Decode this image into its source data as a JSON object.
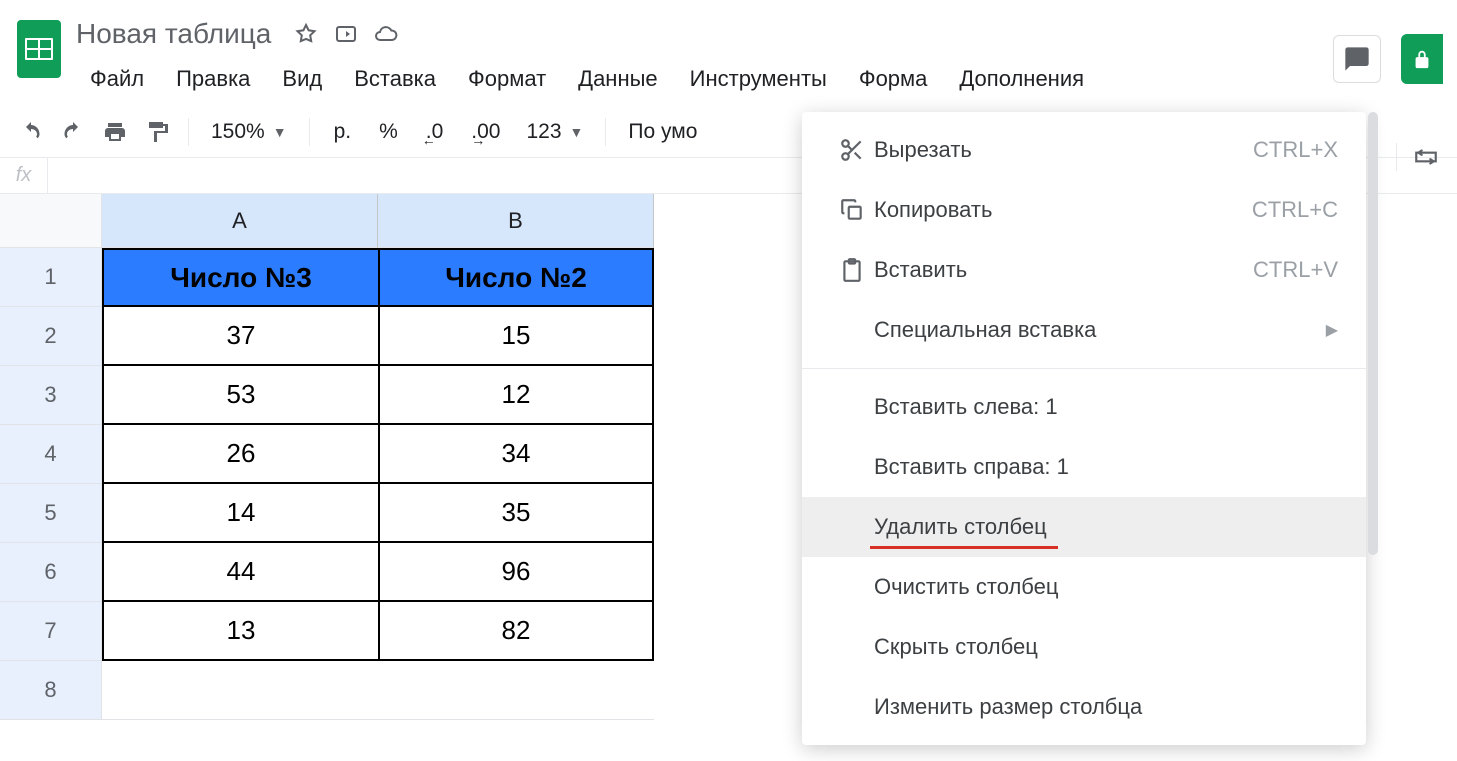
{
  "doc_title": "Новая таблица",
  "menu": [
    "Файл",
    "Правка",
    "Вид",
    "Вставка",
    "Формат",
    "Данные",
    "Инструменты",
    "Форма",
    "Дополнения"
  ],
  "toolbar": {
    "zoom": "150%",
    "currency": "р.",
    "percent": "%",
    "dec_less": ".0",
    "dec_more": ".00",
    "format_sel": "123",
    "font": "По умо"
  },
  "columns": [
    "A",
    "B"
  ],
  "row_numbers": [
    "1",
    "2",
    "3",
    "4",
    "5",
    "6",
    "7",
    "8"
  ],
  "spreadsheet": {
    "headers": [
      "Число №3",
      "Число №2"
    ],
    "rows": [
      [
        "37",
        "15"
      ],
      [
        "53",
        "12"
      ],
      [
        "26",
        "34"
      ],
      [
        "14",
        "35"
      ],
      [
        "44",
        "96"
      ],
      [
        "13",
        "82"
      ]
    ]
  },
  "context_menu": {
    "cut": {
      "label": "Вырезать",
      "shortcut": "CTRL+X"
    },
    "copy": {
      "label": "Копировать",
      "shortcut": "CTRL+C"
    },
    "paste": {
      "label": "Вставить",
      "shortcut": "CTRL+V"
    },
    "paste_special": {
      "label": "Специальная вставка"
    },
    "insert_left": {
      "label": "Вставить слева: 1"
    },
    "insert_right": {
      "label": "Вставить справа: 1"
    },
    "delete_col": {
      "label": "Удалить столбец"
    },
    "clear_col": {
      "label": "Очистить столбец"
    },
    "hide_col": {
      "label": "Скрыть столбец"
    },
    "resize_col": {
      "label": "Изменить размер столбца"
    }
  },
  "fx_label": "fx"
}
